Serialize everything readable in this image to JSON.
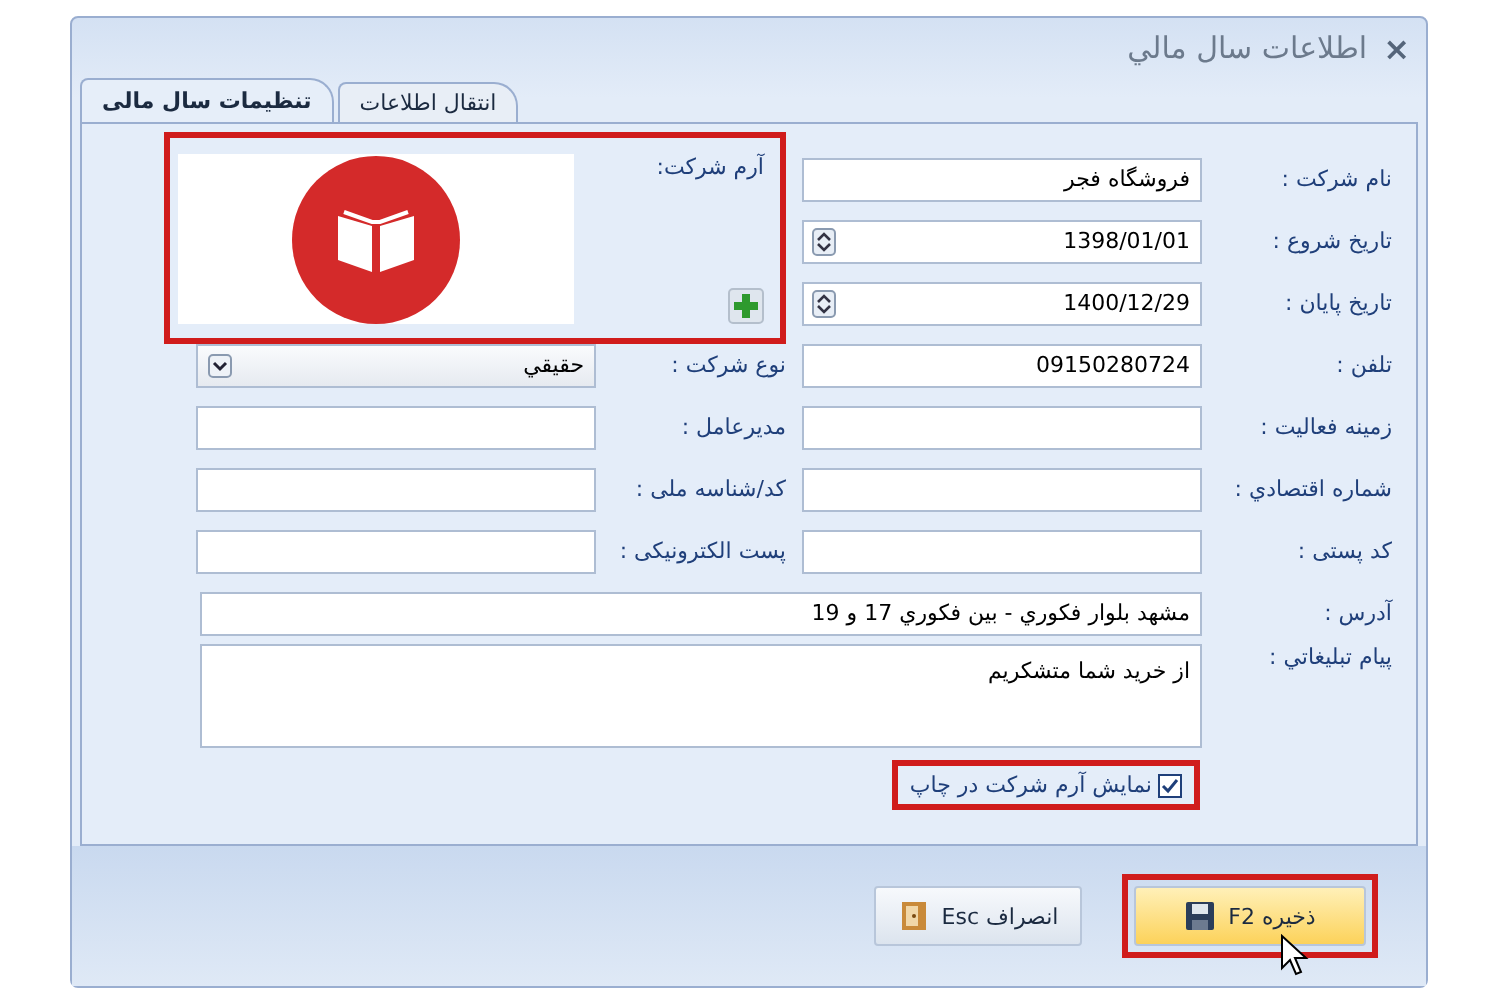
{
  "window": {
    "title": "اطلاعات سال مالي",
    "close": "×"
  },
  "tabs": [
    {
      "label": "انتقال اطلاعات",
      "selected": false
    },
    {
      "label": "تنظیمات سال مالی",
      "selected": true
    }
  ],
  "right_fields": [
    {
      "label": "نام شرکت :",
      "value": "فروشگاه فجر",
      "kind": "text"
    },
    {
      "label": "تاریخ شروع :",
      "value": "1398/01/01",
      "kind": "spin"
    },
    {
      "label": "تاریخ پایان :",
      "value": "1400/12/29",
      "kind": "spin"
    },
    {
      "label": "تلفن :",
      "value": "09150280724",
      "kind": "text"
    },
    {
      "label": "زمینه فعالیت :",
      "kind": "text"
    },
    {
      "label": "شماره اقتصادي :",
      "kind": "text"
    },
    {
      "label": "کد پستی :",
      "kind": "text"
    }
  ],
  "logo": {
    "label": "آرم شرکت:",
    "highlighted": true
  },
  "left_fields": [
    {
      "label": "نوع شرکت :",
      "value": "حقیقي",
      "kind": "dropdown"
    },
    {
      "label": "مدیرعامل :",
      "kind": "text"
    },
    {
      "label": "کد/شناسه ملی :",
      "kind": "text"
    },
    {
      "label": "پست الکترونیکی :",
      "kind": "text"
    }
  ],
  "address": {
    "label": "آدرس :",
    "value": "مشهد بلوار فکوري - بين فکوري 17 و 19"
  },
  "message": {
    "label": "پیام تبلیغاتي :",
    "value": "از خرید شما متشکریم"
  },
  "show_logo": {
    "label": "نمایش آرم شرکت در چاپ",
    "checked": true,
    "highlighted": true
  },
  "buttons": [
    {
      "label": "ذخیره F2",
      "kind": "save",
      "highlighted": true
    },
    {
      "label": "انصراف Esc",
      "kind": "cancel",
      "highlighted": false
    }
  ]
}
